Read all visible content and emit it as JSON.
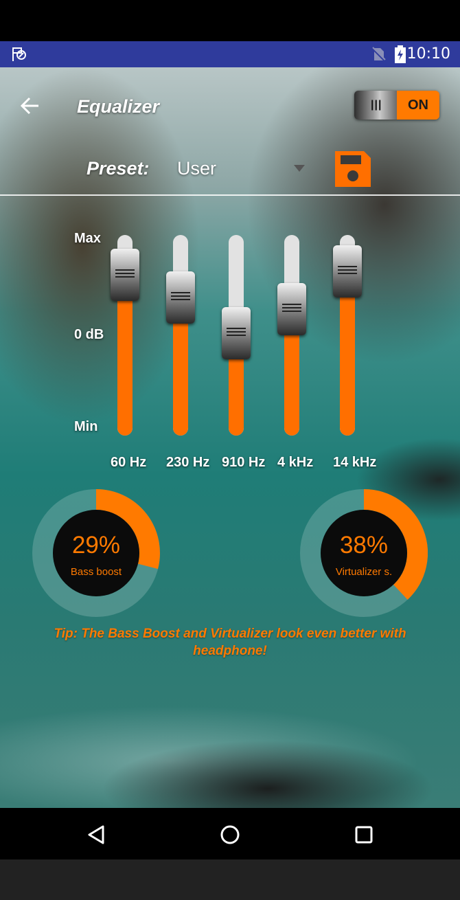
{
  "status_bar": {
    "time": "10:10",
    "color": "#2f3b9c",
    "icons": [
      "app-notification-icon",
      "no-sim-icon",
      "battery-charging-icon"
    ]
  },
  "header": {
    "title": "Equalizer",
    "back_icon": "back-arrow-icon",
    "toggle": {
      "state_label": "ON",
      "grip": "|||",
      "on_color": "#ff7a00"
    }
  },
  "preset": {
    "label": "Preset:",
    "value": "User",
    "save_icon": "save-icon"
  },
  "equalizer": {
    "levels": {
      "max": "Max",
      "mid": "0 dB",
      "min": "Min"
    },
    "accent": "#ff6f00",
    "bands": [
      {
        "label": "60 Hz",
        "level": 0.8
      },
      {
        "label": "230 Hz",
        "level": 0.69
      },
      {
        "label": "910 Hz",
        "level": 0.51
      },
      {
        "label": "4 kHz",
        "level": 0.63
      },
      {
        "label": "14 kHz",
        "level": 0.82
      }
    ]
  },
  "knobs": [
    {
      "percent_text": "29%",
      "value": 29,
      "label": "Bass boost"
    },
    {
      "percent_text": "38%",
      "value": 38,
      "label": "Virtualizer s."
    }
  ],
  "tip": "Tip: The Bass Boost and Virtualizer look even better with headphone!",
  "nav": {
    "icons": [
      "nav-back-icon",
      "nav-home-icon",
      "nav-recents-icon"
    ]
  }
}
